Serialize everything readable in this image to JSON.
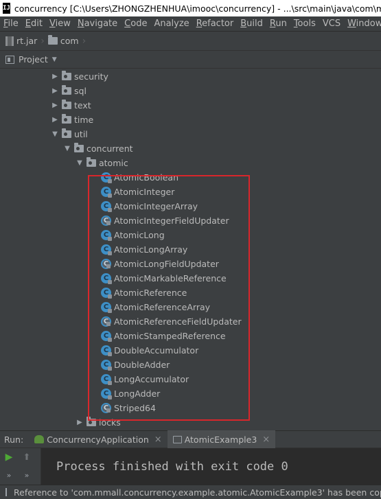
{
  "titlebar": {
    "app_icon": "IJ",
    "title": "concurrency [C:\\Users\\ZHONGZHENHUA\\imooc\\concurrency] - ...\\src\\main\\java\\com\\mmall\\"
  },
  "menubar": {
    "items": [
      {
        "u": "F",
        "rest": "ile"
      },
      {
        "u": "E",
        "rest": "dit"
      },
      {
        "u": "V",
        "rest": "iew"
      },
      {
        "u": "N",
        "rest": "avigate"
      },
      {
        "u": "C",
        "rest": "ode"
      },
      {
        "u": "",
        "rest": "Analyze"
      },
      {
        "u": "R",
        "rest": "efactor"
      },
      {
        "u": "B",
        "rest": "uild"
      },
      {
        "u": "R",
        "rest": "un"
      },
      {
        "u": "T",
        "rest": "ools"
      },
      {
        "u": "",
        "rest": "VCS"
      },
      {
        "u": "W",
        "rest": "indow"
      }
    ]
  },
  "navbar": {
    "crumb1": "rt.jar",
    "crumb2": "com"
  },
  "panel": {
    "title": "Project",
    "caret": "▼"
  },
  "tree": {
    "packages": [
      {
        "label": "security",
        "arrow": "▶"
      },
      {
        "label": "sql",
        "arrow": "▶"
      },
      {
        "label": "text",
        "arrow": "▶"
      },
      {
        "label": "time",
        "arrow": "▶"
      },
      {
        "label": "util",
        "arrow": "▼"
      }
    ],
    "concurrent": {
      "label": "concurrent",
      "arrow": "▼"
    },
    "atomic": {
      "label": "atomic",
      "arrow": "▼"
    },
    "classes": [
      {
        "label": "AtomicBoolean",
        "abstract": false
      },
      {
        "label": "AtomicInteger",
        "abstract": false
      },
      {
        "label": "AtomicIntegerArray",
        "abstract": false
      },
      {
        "label": "AtomicIntegerFieldUpdater",
        "abstract": true
      },
      {
        "label": "AtomicLong",
        "abstract": false
      },
      {
        "label": "AtomicLongArray",
        "abstract": false
      },
      {
        "label": "AtomicLongFieldUpdater",
        "abstract": true
      },
      {
        "label": "AtomicMarkableReference",
        "abstract": false
      },
      {
        "label": "AtomicReference",
        "abstract": false
      },
      {
        "label": "AtomicReferenceArray",
        "abstract": false
      },
      {
        "label": "AtomicReferenceFieldUpdater",
        "abstract": true
      },
      {
        "label": "AtomicStampedReference",
        "abstract": false
      },
      {
        "label": "DoubleAccumulator",
        "abstract": false
      },
      {
        "label": "DoubleAdder",
        "abstract": false
      },
      {
        "label": "LongAccumulator",
        "abstract": false
      },
      {
        "label": "LongAdder",
        "abstract": false
      },
      {
        "label": "Striped64",
        "abstract": true
      }
    ],
    "locks": {
      "label": "locks",
      "arrow": "▶"
    },
    "class_icon_letter": "C"
  },
  "runbar": {
    "label": "Run:",
    "tab1": "ConcurrencyApplication",
    "tab2": "AtomicExample3",
    "close": "×"
  },
  "console": {
    "output": "Process finished with exit code 0",
    "run_glyph": "▶",
    "up_glyph": "⬆",
    "more_glyph": "»"
  },
  "statusbar": {
    "message": "Reference to 'com.mmall.concurrency.example.atomic.AtomicExample3' has been copied."
  },
  "colors": {
    "highlight_border": "#d9262b",
    "class_icon": "#3d8fc6",
    "run_green": "#4ea836"
  }
}
